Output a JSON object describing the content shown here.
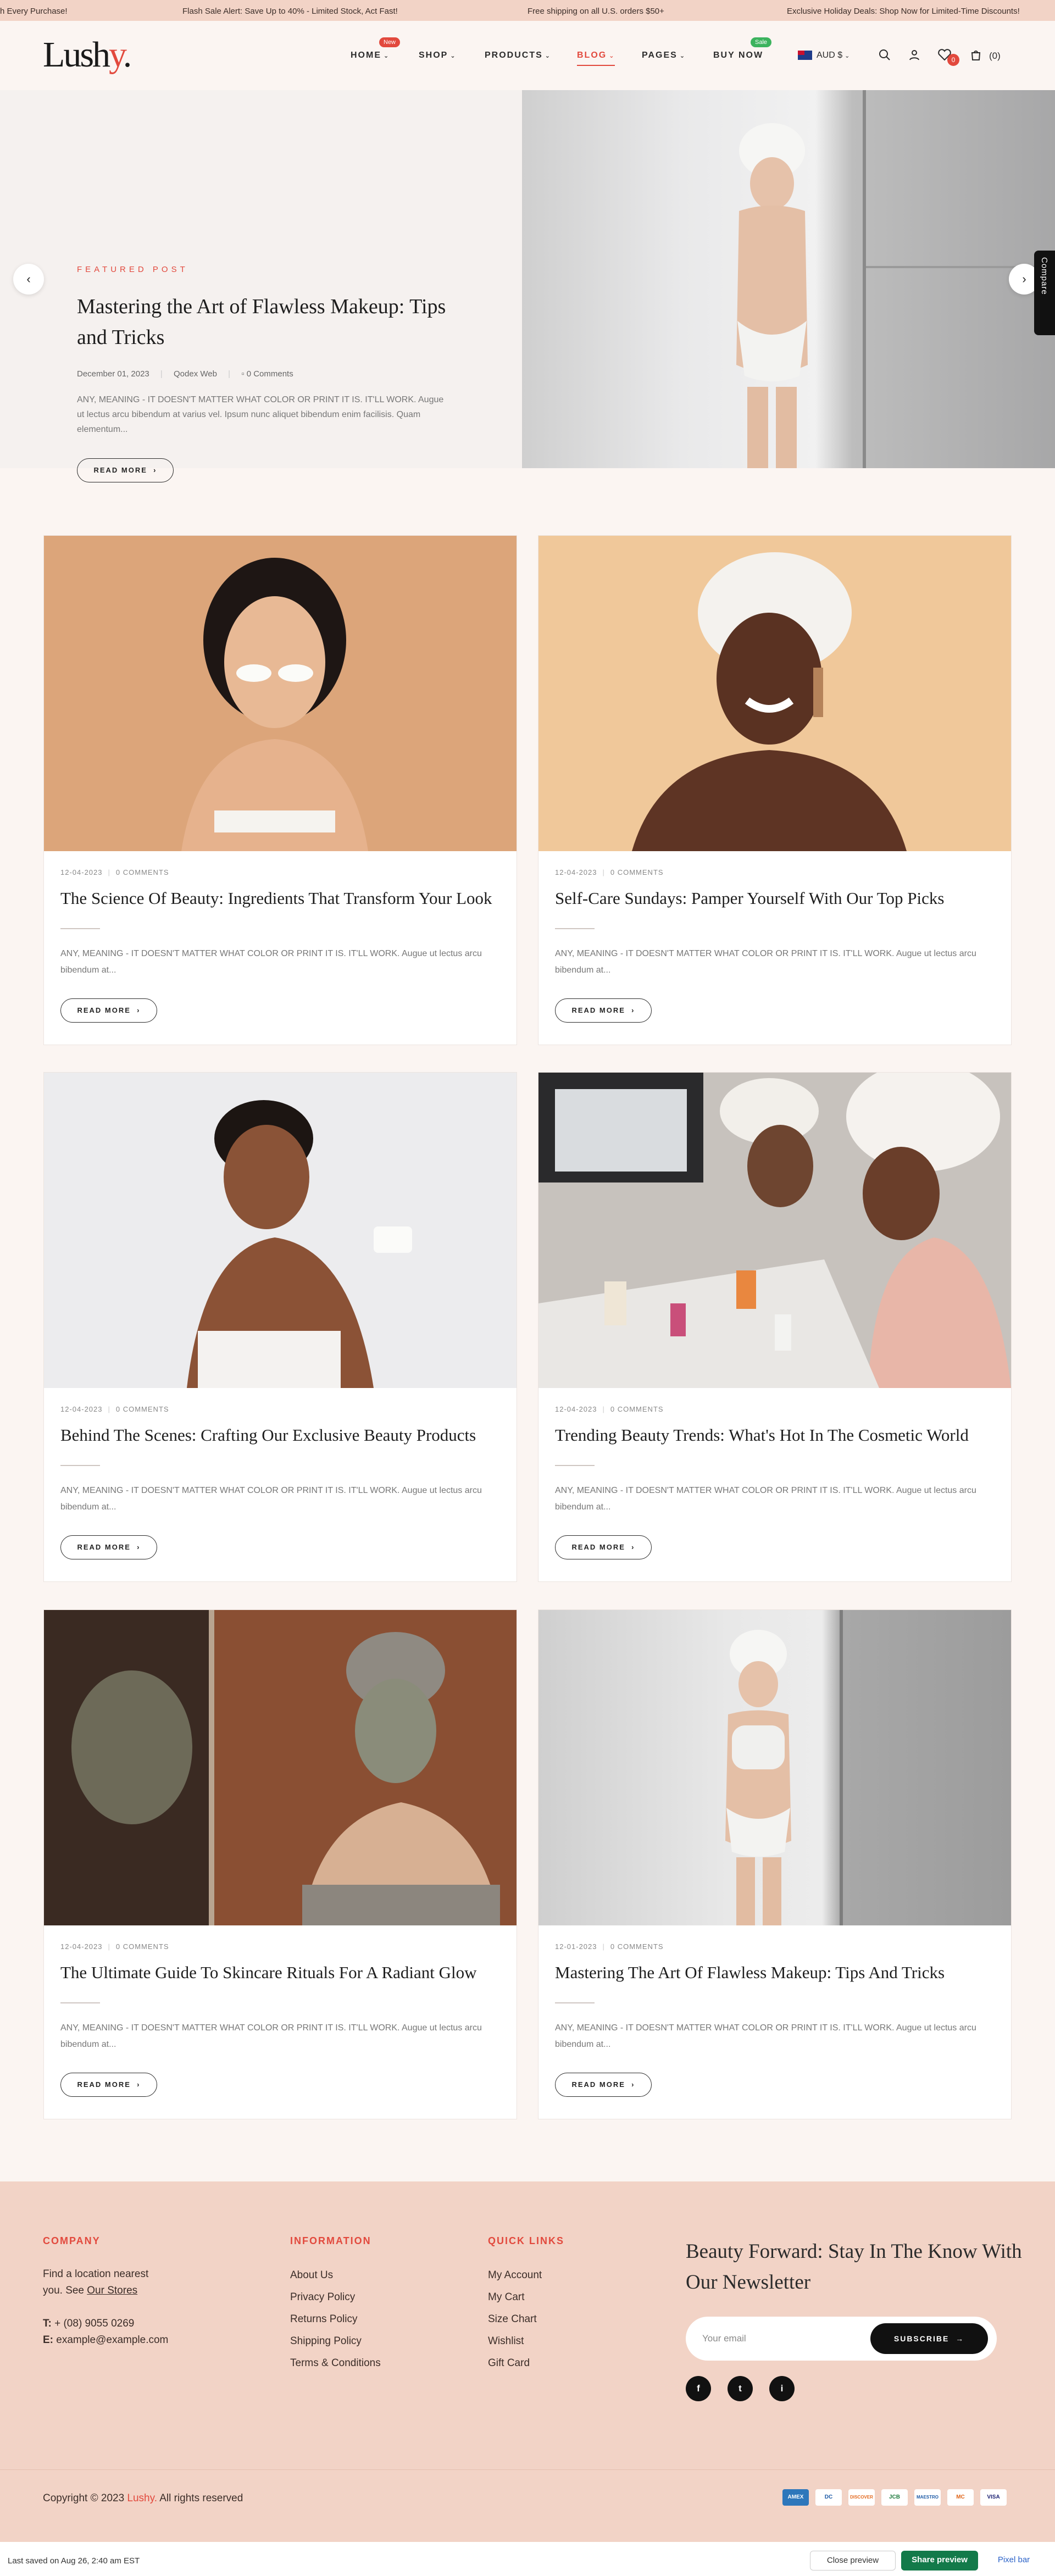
{
  "announcements": [
    "h Every Purchase!",
    "Flash Sale Alert: Save Up to 40% - Limited Stock, Act Fast!",
    "Free shipping on all U.S. orders $50+",
    "Exclusive Holiday Deals: Shop Now for Limited-Time Discounts!"
  ],
  "logo": {
    "main": "Lush",
    "accent": "y",
    "dot": "."
  },
  "nav": {
    "home": "HOME",
    "home_badge": "New",
    "shop": "SHOP",
    "products": "PRODUCTS",
    "blog": "BLOG",
    "pages": "PAGES",
    "buy_now": "BUY NOW",
    "buy_badge": "Sale",
    "currency": "AUD $",
    "wishlist_count": "0",
    "cart_count": "(0)"
  },
  "hero": {
    "eyebrow": "FEATURED POST",
    "title": "Mastering the Art of Flawless Makeup: Tips and Tricks",
    "date": "December 01, 2023",
    "author": "Qodex Web",
    "comments": "0 Comments",
    "excerpt": "ANY, MEANING - IT DOESN'T MATTER WHAT COLOR OR PRINT IT IS. IT'LL WORK. Augue ut lectus arcu bibendum at varius vel. Ipsum nunc aliquet bibendum enim facilisis. Quam elementum...",
    "read_more": "READ MORE",
    "compare": "Compare"
  },
  "posts": [
    {
      "date": "12-04-2023",
      "comments": "0 COMMENTS",
      "title": "The Science Of Beauty: Ingredients That Transform Your Look",
      "excerpt": "ANY, MEANING - IT DOESN'T MATTER WHAT COLOR OR PRINT IT IS. IT'LL WORK. Augue ut lectus arcu bibendum at...",
      "cta": "READ MORE"
    },
    {
      "date": "12-04-2023",
      "comments": "0 COMMENTS",
      "title": "Self-Care Sundays: Pamper Yourself With Our Top Picks",
      "excerpt": "ANY, MEANING - IT DOESN'T MATTER WHAT COLOR OR PRINT IT IS. IT'LL WORK. Augue ut lectus arcu bibendum at...",
      "cta": "READ MORE"
    },
    {
      "date": "12-04-2023",
      "comments": "0 COMMENTS",
      "title": "Behind The Scenes: Crafting Our Exclusive Beauty Products",
      "excerpt": "ANY, MEANING - IT DOESN'T MATTER WHAT COLOR OR PRINT IT IS. IT'LL WORK. Augue ut lectus arcu bibendum at...",
      "cta": "READ MORE"
    },
    {
      "date": "12-04-2023",
      "comments": "0 COMMENTS",
      "title": "Trending Beauty Trends: What's Hot In The Cosmetic World",
      "excerpt": "ANY, MEANING - IT DOESN'T MATTER WHAT COLOR OR PRINT IT IS. IT'LL WORK. Augue ut lectus arcu bibendum at...",
      "cta": "READ MORE"
    },
    {
      "date": "12-04-2023",
      "comments": "0 COMMENTS",
      "title": "The Ultimate Guide To Skincare Rituals For A Radiant Glow",
      "excerpt": "ANY, MEANING - IT DOESN'T MATTER WHAT COLOR OR PRINT IT IS. IT'LL WORK. Augue ut lectus arcu bibendum at...",
      "cta": "READ MORE"
    },
    {
      "date": "12-01-2023",
      "comments": "0 COMMENTS",
      "title": "Mastering The Art Of Flawless Makeup: Tips And Tricks",
      "excerpt": "ANY, MEANING - IT DOESN'T MATTER WHAT COLOR OR PRINT IT IS. IT'LL WORK. Augue ut lectus arcu bibendum at...",
      "cta": "READ MORE"
    }
  ],
  "footer": {
    "company": {
      "heading": "COMPANY",
      "line1": "Find a location nearest",
      "line2_prefix": "you. See",
      "stores_link": "Our Stores",
      "phone_label": "T:",
      "phone": "+ (08) 9055 0269",
      "email_label": "E:",
      "email": "example@example.com"
    },
    "information": {
      "heading": "INFORMATION",
      "links": [
        "About Us",
        "Privacy Policy",
        "Returns Policy",
        "Shipping Policy",
        "Terms & Conditions"
      ]
    },
    "quick_links": {
      "heading": "QUICK LINKS",
      "links": [
        "My Account",
        "My Cart",
        "Size Chart",
        "Wishlist",
        "Gift Card"
      ]
    },
    "newsletter": {
      "title": "Beauty Forward: Stay In The Know With Our Newsletter",
      "placeholder": "Your email",
      "subscribe": "SUBSCRIBE"
    },
    "social": [
      "f",
      "t",
      "i"
    ],
    "copyright_prefix": "Copyright © 2023",
    "copyright_brand": "Lushy.",
    "copyright_suffix": "All rights reserved",
    "payments": [
      "AMEX",
      "DC",
      "DISCOVER",
      "JCB",
      "MAESTRO",
      "MC",
      "VISA"
    ]
  },
  "editor_bar": {
    "saved": "Last saved on Aug 26, 2:40 am EST",
    "close_preview": "Close preview",
    "share_preview": "Share preview",
    "pixel_bar": "Pixel bar"
  },
  "colors": {
    "accent": "#e2493d",
    "topbar": "#f2d3c6",
    "page_bg": "#fbf5f2",
    "new_badge": "#e2493d",
    "sale_badge": "#3cb35e"
  },
  "icons": [
    "search-icon",
    "user-icon",
    "wishlist-icon",
    "cart-icon",
    "chevron-down-icon",
    "comment-icon",
    "arrow-left-icon",
    "arrow-right-icon"
  ]
}
